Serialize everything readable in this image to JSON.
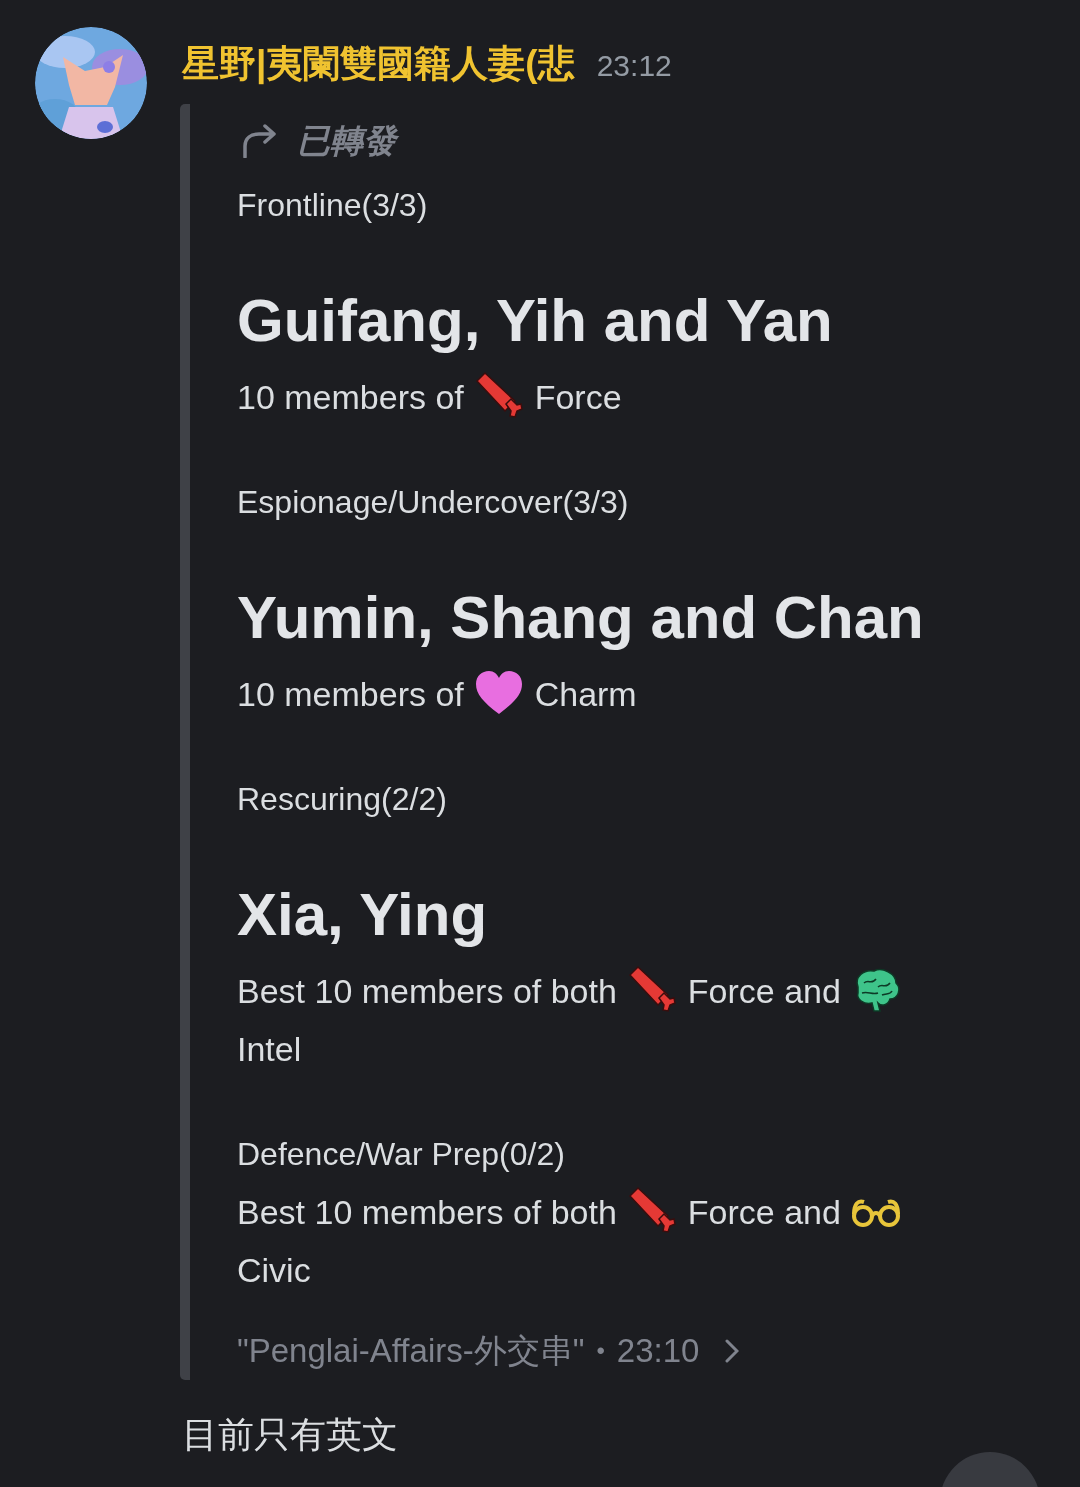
{
  "author": {
    "name": "星野|夷闌雙國籍人妻(悲",
    "time": "23:12"
  },
  "forward": {
    "label": "已轉發",
    "sections": [
      {
        "title": "Frontline(3/3)",
        "heading": "Guifang, Yih and Yan",
        "description": [
          {
            "kind": "text",
            "text": "10 members of"
          },
          {
            "kind": "sword"
          },
          {
            "kind": "text",
            "text": "Force"
          }
        ]
      },
      {
        "title": "Espionage/Undercover(3/3)",
        "heading": "Yumin, Shang and Chan",
        "description": [
          {
            "kind": "text",
            "text": "10 members of"
          },
          {
            "kind": "heart"
          },
          {
            "kind": "text",
            "text": "Charm"
          }
        ]
      },
      {
        "title": "Rescuring(2/2)",
        "heading": "Xia, Ying",
        "description": [
          {
            "kind": "text",
            "text": "Best 10 members of both"
          },
          {
            "kind": "sword"
          },
          {
            "kind": "text",
            "text": "Force and"
          },
          {
            "kind": "brain"
          },
          {
            "kind": "text",
            "text": "Intel"
          }
        ]
      },
      {
        "title": "Defence/War Prep(0/2)",
        "description": [
          {
            "kind": "text",
            "text": "Best 10 members of both"
          },
          {
            "kind": "sword"
          },
          {
            "kind": "text",
            "text": "Force and"
          },
          {
            "kind": "glasses"
          },
          {
            "kind": "text",
            "text": "Civic"
          }
        ]
      }
    ],
    "source": "\"Penglai-Affairs-外交串\"",
    "separator": "•",
    "time": "23:10"
  },
  "reply": "目前只有英文"
}
